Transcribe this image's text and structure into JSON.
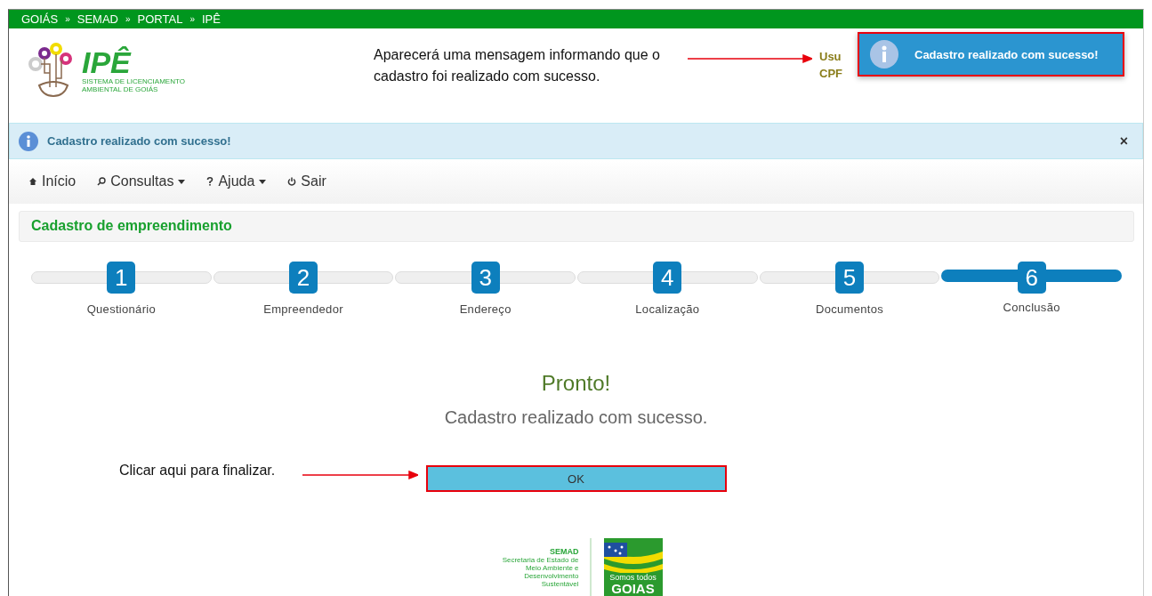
{
  "breadcrumb": [
    "GOIÁS",
    "»",
    "SEMAD",
    "»",
    "PORTAL",
    "»",
    "IPÊ"
  ],
  "logo": {
    "title": "IPÊ",
    "subtitle": "SISTEMA DE LICENCIAMENTO AMBIENTAL DE GOIÁS"
  },
  "user_info": {
    "line_1": "Usu",
    "line_2": "CPF"
  },
  "toast": {
    "message": "Cadastro realizado com sucesso!"
  },
  "alert": {
    "message": "Cadastro realizado com sucesso!",
    "close": "×"
  },
  "nav": [
    {
      "label": "Início",
      "kind": "home",
      "dropdown": false
    },
    {
      "label": "Consultas",
      "kind": "search",
      "dropdown": true
    },
    {
      "label": "Ajuda",
      "kind": "help",
      "dropdown": true
    },
    {
      "label": "Sair",
      "kind": "power",
      "dropdown": false
    }
  ],
  "panel": {
    "title": "Cadastro de empreendimento"
  },
  "steps": [
    {
      "number": "1",
      "label": "Questionário",
      "selected": false
    },
    {
      "number": "2",
      "label": "Empreendedor",
      "selected": false
    },
    {
      "number": "3",
      "label": "Endereço",
      "selected": false
    },
    {
      "number": "4",
      "label": "Localização",
      "selected": false
    },
    {
      "number": "5",
      "label": "Documentos",
      "selected": false
    },
    {
      "number": "6",
      "label": "Conclusão",
      "selected": true
    }
  ],
  "result": {
    "title": "Pronto!",
    "message": "Cadastro realizado com sucesso.",
    "button": "OK"
  },
  "annotations": [
    {
      "text": "Aparecerá uma mensagem informando que o cadastro foi realizado com sucesso."
    },
    {
      "text": "Clicar aqui para finalizar."
    }
  ],
  "footer": {
    "semad_title": "SEMAD",
    "semad_text": "Secretaria de Estado de Meio Ambiente e Desenvolvimento Sustentável",
    "goias_line_1": "Somos todos",
    "goias_line_2": "GOIAS"
  }
}
